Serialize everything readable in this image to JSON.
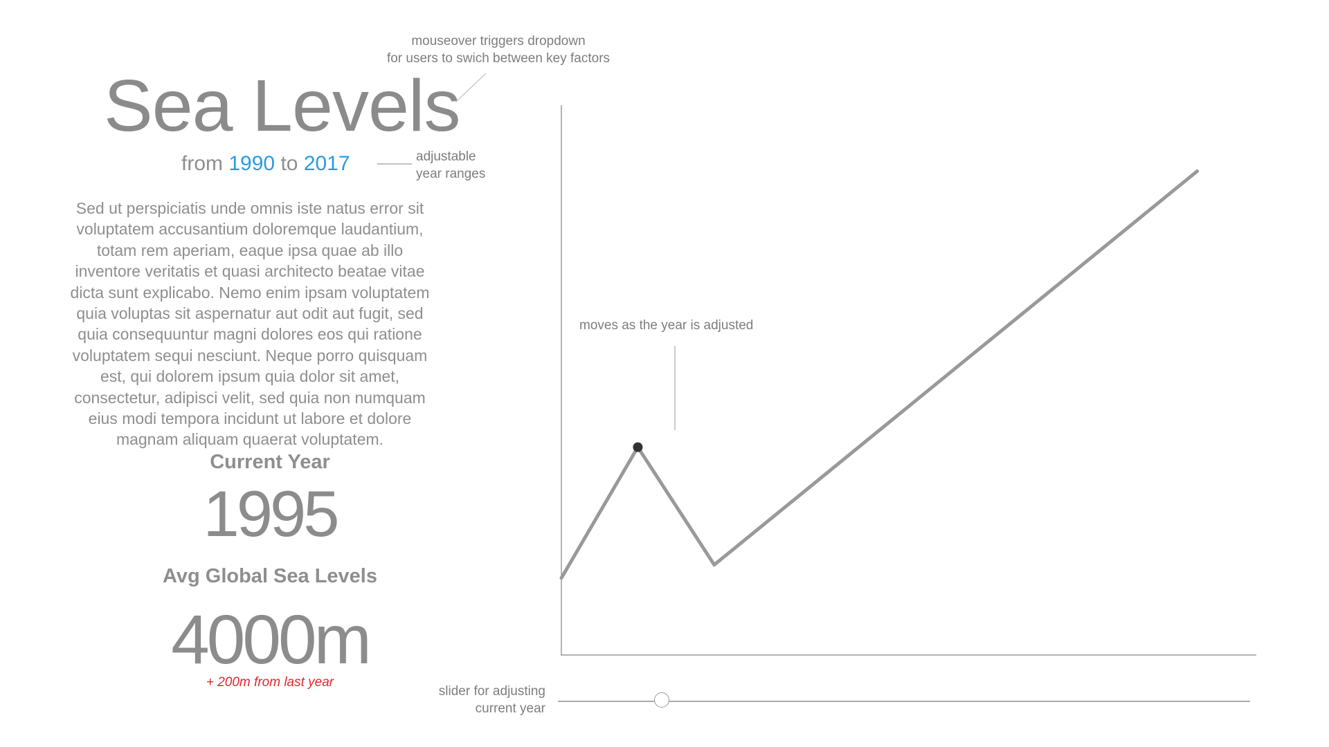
{
  "title": "Sea Levels",
  "subtitle": {
    "from_word": "from",
    "start_year": "1990",
    "to_word": "to",
    "end_year": "2017"
  },
  "description": "Sed ut perspiciatis unde omnis iste natus error sit voluptatem accusantium doloremque laudantium, totam rem aperiam, eaque ipsa quae ab illo inventore veritatis et quasi architecto beatae vitae dicta sunt explicabo. Nemo enim ipsam voluptatem quia voluptas sit aspernatur aut odit aut fugit, sed quia consequuntur magni dolores eos qui ratione voluptatem sequi nesciunt. Neque porro quisquam est, qui dolorem ipsum quia dolor sit amet, consectetur, adipisci velit, sed quia non numquam eius modi tempora incidunt ut labore et dolore magnam aliquam quaerat voluptatem.",
  "current_year": {
    "label": "Current Year",
    "value": "1995"
  },
  "avg_sea_level": {
    "label": "Avg Global Sea Levels",
    "value": "4000m",
    "change": "+ 200m from last year",
    "change_color": "#e0262c"
  },
  "annotations": {
    "dropdown_line1": "mouseover triggers dropdown",
    "dropdown_line2": "for users to swich between key factors",
    "range_line1": "adjustable",
    "range_line2": "year ranges",
    "marker": "moves as the year is adjusted",
    "slider_line1": "slider for adjusting",
    "slider_line2": "current year"
  },
  "colors": {
    "accent": "#2a9ae3",
    "text": "#8e8e8e",
    "line": "#999999",
    "marker": "#333333"
  },
  "chart_data": {
    "type": "line",
    "title": "",
    "xlabel": "",
    "ylabel": "",
    "grid": false,
    "points": [
      {
        "x": 0,
        "y": 0.14
      },
      {
        "x": 0.11,
        "y": 0.378
      },
      {
        "x": 0.22,
        "y": 0.164
      },
      {
        "x": 0.915,
        "y": 0.88
      }
    ],
    "highlight_index": 1
  },
  "slider": {
    "value": 0.15
  }
}
